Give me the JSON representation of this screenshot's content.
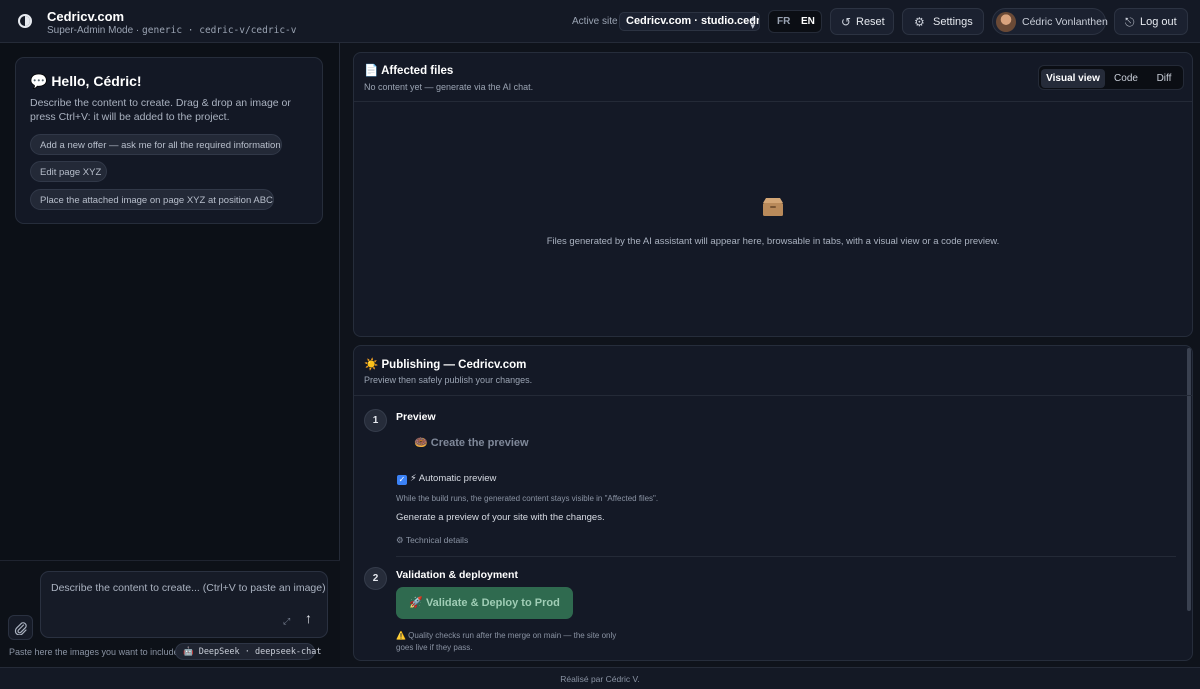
{
  "header": {
    "title": "Cedricv.com",
    "subtitle_mode": "Super-Admin Mode ·",
    "subtitle_code": "generic · cedric-v/cedric-v",
    "active_site_label": "Active site",
    "active_site_value": "Cedricv.com · studio.cedric",
    "languages": [
      "FR",
      "EN"
    ],
    "selected_language": "EN",
    "reset_label": "Reset",
    "settings_label": "Settings",
    "user_name": "Cédric Vonlanthen",
    "logout_label": "Log out"
  },
  "chat": {
    "greeting": "💬 Hello, Cédric!",
    "description": "Describe the content to create. Drag & drop an image or press Ctrl+V: it will be added to the project.",
    "suggestions": [
      "Add a new offer — ask me for all the required information",
      "Edit page XYZ",
      "Place the attached image on page XYZ at position ABC"
    ],
    "input_placeholder": "Describe the content to create... (Ctrl+V to paste an image)",
    "paste_hint": "Paste here the images you want to include",
    "model_chip": "🤖 DeepSeek · deepseek-chat"
  },
  "files": {
    "title": "📄 Affected files",
    "subtitle": "No content yet — generate via the AI chat.",
    "tabs": [
      "Visual view",
      "Code",
      "Diff"
    ],
    "active_tab": "Visual view",
    "empty_message": "Files generated by the AI assistant will appear here, browsable in tabs, with a visual view or a code preview."
  },
  "publishing": {
    "title": "☀️ Publishing — Cedricv.com",
    "subtitle": "Preview then safely publish your changes.",
    "steps": [
      {
        "number": "1",
        "title": "Preview",
        "button_label": "🍩 Create the preview",
        "auto_preview_label": "⚡ Automatic preview",
        "auto_preview_checked": true,
        "note": "While the build runs, the generated content stays visible in \"Affected files\".",
        "description": "Generate a preview of your site with the changes.",
        "details_label": "⚙ Technical details"
      },
      {
        "number": "2",
        "title": "Validation & deployment",
        "button_label": "🚀 Validate & Deploy to Prod",
        "warning": "⚠️ Quality checks run after the merge on main — the site only goes live if they pass."
      }
    ]
  },
  "footer": {
    "credit": "Réalisé par Cédric V."
  },
  "colors": {
    "background": "#0f131b",
    "panel": "#141926",
    "accent_checkbox": "#3b82f6",
    "deploy_button": "#2f6a4f"
  },
  "icons": [
    "theme-toggle-icon",
    "reset-icon",
    "gear-icon",
    "logout-icon",
    "paperclip-icon",
    "send-arrow-icon",
    "expand-icon",
    "box-icon"
  ]
}
